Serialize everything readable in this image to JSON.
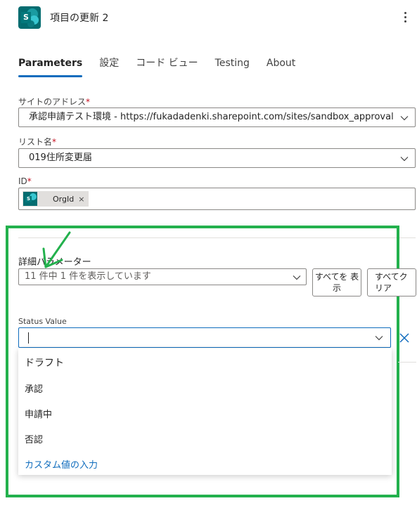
{
  "header": {
    "title": "項目の更新 2",
    "app_icon": "sharepoint-icon",
    "more_icon": "more-vertical-icon"
  },
  "tabs": [
    {
      "label": "Parameters",
      "active": true
    },
    {
      "label": "設定",
      "active": false
    },
    {
      "label": "コード ビュー",
      "active": false
    },
    {
      "label": "Testing",
      "active": false
    },
    {
      "label": "About",
      "active": false
    }
  ],
  "fields": {
    "site_address": {
      "label": "サイトのアドレス",
      "required": "*",
      "value": "承認申請テスト環境 - https://fukadadenki.sharepoint.com/sites/sandbox_approval"
    },
    "list_name": {
      "label": "リスト名",
      "required": "*",
      "value": "019住所変更届"
    },
    "id": {
      "label": "ID",
      "required": "*",
      "token_text": "OrgId",
      "token_remove": "×"
    }
  },
  "advanced": {
    "label": "詳細パラメーター",
    "select_text": "11 件中 1 件を表示しています",
    "show_all_label": "すべてを 表示",
    "clear_all_label": "すべてク リア"
  },
  "status_value": {
    "label": "Status Value",
    "value": "",
    "options": [
      {
        "label": "ドラフト"
      },
      {
        "label": "承認"
      },
      {
        "label": "申請中"
      },
      {
        "label": "否認"
      }
    ],
    "custom_entry_label": "カスタム値の入力"
  },
  "colors": {
    "accent": "#0f6cbd",
    "annotation_box": "#23b14d",
    "sharepoint": "#036c70",
    "required": "#c50f1f"
  }
}
